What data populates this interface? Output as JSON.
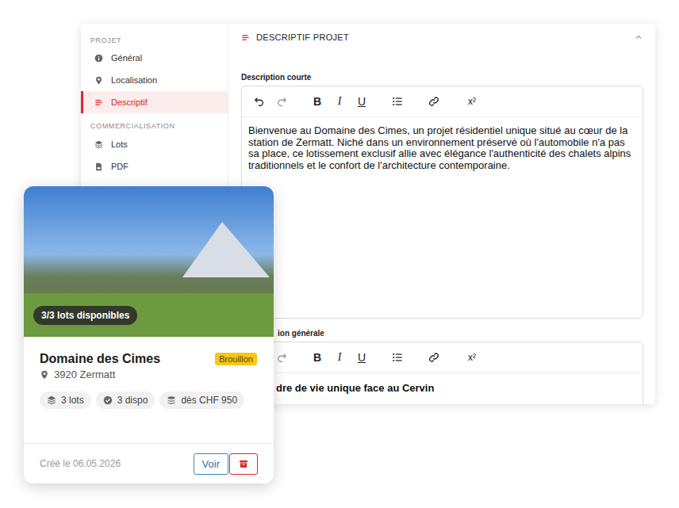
{
  "sidebar": {
    "sections": [
      {
        "title": "PROJET",
        "items": [
          {
            "label": "Général",
            "selected": false
          },
          {
            "label": "Localisation",
            "selected": false
          },
          {
            "label": "Descriptif",
            "selected": true
          }
        ]
      },
      {
        "title": "COMMERCIALISATION",
        "items": [
          {
            "label": "Lots",
            "selected": false
          },
          {
            "label": "PDF",
            "selected": false
          }
        ]
      }
    ]
  },
  "panel": {
    "title": "DESCRIPTIF PROJET",
    "expanded": true
  },
  "toolbar": {
    "undo_disabled": false,
    "redo_disabled": true,
    "format": [
      "B",
      "I",
      "U"
    ],
    "superscript": "x²"
  },
  "editors": [
    {
      "label": "Description courte",
      "content": "Bienvenue au Domaine des Cimes, un projet résidentiel unique situé au cœur de la station de Zermatt. Niché dans un environnement préservé où l'automobile n'a pas sa place, ce lotissement exclusif allie avec élégance l'authenticité des chalets alpins traditionnels et le confort de l'architecture contemporaine.",
      "kind": "paragraph",
      "cut": false
    },
    {
      "label": "ion générale",
      "content": "dre de vie unique face au Cervin",
      "kind": "heading",
      "cut": true
    }
  ],
  "card": {
    "availability": "3/3 lots disponibles",
    "title": "Domaine des Cimes",
    "status_badge": "Brouillon",
    "location": "3920 Zermatt",
    "stats": [
      "3 lots",
      "3 dispo",
      "dès CHF 950"
    ],
    "created": "Créé le 06.05.2026",
    "view_button": "Voir"
  }
}
